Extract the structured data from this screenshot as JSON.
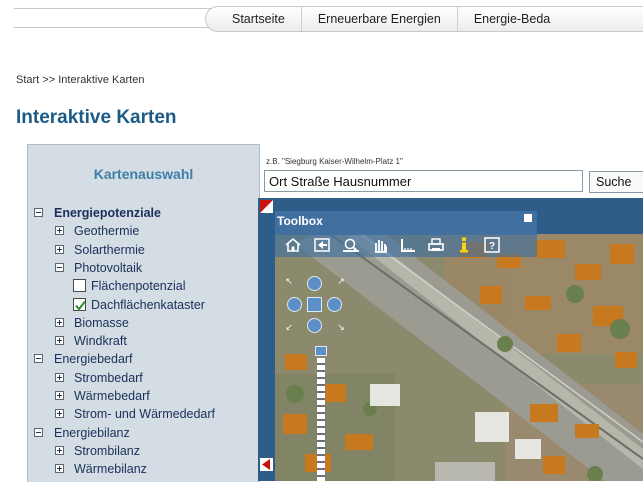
{
  "nav": {
    "tabs": [
      {
        "label": "Startseite"
      },
      {
        "label": "Erneuerbare Energien"
      },
      {
        "label": "Energie-Beda"
      }
    ]
  },
  "breadcrumb": {
    "start": "Start",
    "separator": ">>",
    "current": "Interaktive Karten"
  },
  "page_title": "Interaktive Karten",
  "sidebar": {
    "heading": "Kartenauswahl",
    "groups": [
      {
        "label": "Energiepotenziale",
        "expanded": true,
        "children": [
          {
            "label": "Geothermie",
            "expanded": false
          },
          {
            "label": "Solarthermie",
            "expanded": false
          },
          {
            "label": "Photovoltaik",
            "expanded": true,
            "layers": [
              {
                "label": "Flächenpotenzial",
                "checked": false
              },
              {
                "label": "Dachflächenkataster",
                "checked": true
              }
            ]
          },
          {
            "label": "Biomasse",
            "expanded": false
          },
          {
            "label": "Windkraft",
            "expanded": false
          }
        ]
      },
      {
        "label": "Energiebedarf",
        "expanded": true,
        "children": [
          {
            "label": "Strombedarf",
            "expanded": false
          },
          {
            "label": "Wärmebedarf",
            "expanded": false
          },
          {
            "label": "Strom- und Wärmededarf",
            "expanded": false
          }
        ]
      },
      {
        "label": "Energiebilanz",
        "expanded": true,
        "children": [
          {
            "label": "Strombilanz",
            "expanded": false
          },
          {
            "label": "Wärmebilanz",
            "expanded": false
          }
        ]
      }
    ]
  },
  "search": {
    "hint": "z.B. \"Siegburg Kaiser-Wilhelm-Platz 1\"",
    "value": "Ort Straße Hausnummer",
    "button_label": "Suche"
  },
  "map": {
    "toolbox_label": "Toolbox",
    "tools": [
      "home-icon",
      "back-icon",
      "zoom-box-icon",
      "pan-hand-icon",
      "measure-icon",
      "print-icon",
      "info-icon",
      "help-icon"
    ],
    "colors": {
      "panel": "#2f5d8a",
      "toolbox": "#4170a0",
      "accent_red": "#cc1111",
      "info_yellow": "#f2d21a"
    }
  },
  "colors": {
    "title": "#1d5b87",
    "sidebar_bg": "#d3dde3",
    "sidebar_heading": "#3f7ea8",
    "tree_text": "#1c2f5c"
  }
}
